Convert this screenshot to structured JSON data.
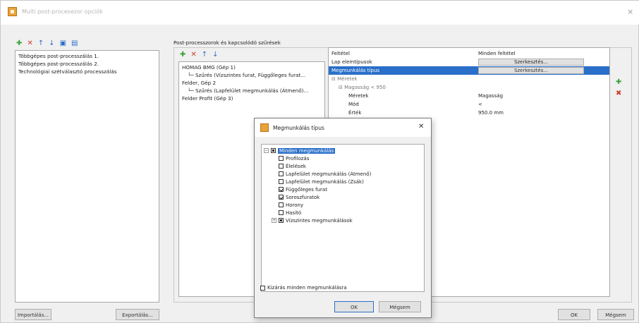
{
  "window": {
    "title": "Multi post-procesezor opciók",
    "close": "×"
  },
  "toolbar": {
    "add": "✚",
    "remove": "✕",
    "up": "↑",
    "down": "↓",
    "save": "▣",
    "open": "▤"
  },
  "left_list": {
    "items": [
      "Többgépes post-processzálás 1.",
      "Többgépes post-processzálás 2.",
      "Technológiai szétválasztó processzálás"
    ]
  },
  "left_buttons": {
    "import": "Importálás...",
    "export": "Exportálás..."
  },
  "middle": {
    "header": "Post-processzorok és kapcsolódó szűrések",
    "toolbar": {
      "add": "✚",
      "remove": "✕",
      "up": "↑",
      "down": "↓"
    },
    "items": [
      "HOMAG BMG (Gép 1)",
      "└─ Szűrés (Vízszintes furat, Függőleges furat...",
      "Felder, Gép 2",
      "└─ Szűrés (Lapfelület megmunkálás (Átmenő)...",
      "Felder Profit (Gép 3)"
    ]
  },
  "properties": {
    "rows": [
      {
        "name": "Feltétel",
        "value": "Minden feltétel",
        "button": ""
      },
      {
        "name": "Lap elemtípusok",
        "value": "",
        "button": "Szerkesztés..."
      },
      {
        "name": "Megmunkálás típus",
        "value": "",
        "button": "Szerkesztés...",
        "selected": true
      },
      {
        "name": "⊟ Méretek",
        "value": "",
        "button": ""
      },
      {
        "name": "⊟ Magasság < 950",
        "value": "",
        "button": ""
      },
      {
        "name": "Méretek",
        "value": "Magasság",
        "button": ""
      },
      {
        "name": "Mód",
        "value": "<",
        "button": ""
      },
      {
        "name": "Érték",
        "value": "950.0 mm",
        "button": ""
      }
    ],
    "side_add": "✚",
    "side_remove": "✖"
  },
  "bottom_buttons": {
    "ok": "OK",
    "cancel": "Mégsem"
  },
  "dialog": {
    "title": "Megmunkálás típus",
    "close": "✕",
    "root": "Minden megmunkálás",
    "items": [
      {
        "label": "Profilozás",
        "checked": false
      },
      {
        "label": "Élelések",
        "checked": false
      },
      {
        "label": "Lapfelület megmunkálás (Átmenő)",
        "checked": false
      },
      {
        "label": "Lapfelület megmunkálás (Zsák)",
        "checked": false
      },
      {
        "label": "Függőleges furat",
        "checked": true
      },
      {
        "label": "Soroszfuratok",
        "checked": true
      },
      {
        "label": "Horony",
        "checked": false
      },
      {
        "label": "Hasító",
        "checked": false
      }
    ],
    "subgroup": "Vízszintes megmunkálások",
    "footer_checkbox": "Kizárás minden megmunkálásra",
    "ok": "OK",
    "cancel": "Mégsem"
  },
  "colors": {
    "selection": "#2a6fc9",
    "add_green": "#3aa13a",
    "remove_red": "#d23a2a",
    "dialog_icon": "#e8a33a"
  }
}
